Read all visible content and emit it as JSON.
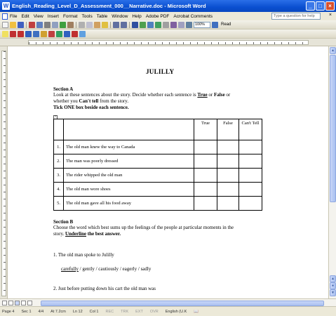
{
  "window": {
    "title": "English_Reading_Level_D_Assessment_000__Narrative.doc - Microsoft Word",
    "minimize": "_",
    "maximize": "□",
    "close": "×"
  },
  "menu": {
    "items": [
      "File",
      "Edit",
      "View",
      "Insert",
      "Format",
      "Tools",
      "Table",
      "Window",
      "Help",
      "Adobe PDF",
      "Acrobat Comments"
    ],
    "help_placeholder": "Type a question for help",
    "close": "×"
  },
  "toolbar": {
    "zoom": "100%",
    "read_label": "Read",
    "colors": {
      "accent": "#0a4fd0"
    }
  },
  "document": {
    "title": "JULILLY",
    "section_a": {
      "heading": "Section A",
      "line1_pre": "Look at these sentences about the story.  Decide whether each sentence is ",
      "true_word": "True",
      "line1_or": " or ",
      "false_word": "False",
      "line1_post": " or",
      "line2_pre": "whether you ",
      "cant_tell": "Can't tell",
      "line2_post": " from the story.",
      "instruction": "Tick ONE box beside each sentence."
    },
    "table": {
      "headers": [
        "True",
        "False",
        "Can't Tell"
      ],
      "rows": [
        {
          "num": "1.",
          "text": "The old man knew the way to Canada"
        },
        {
          "num": "2.",
          "text": "The man was poorly dressed"
        },
        {
          "num": "3.",
          "text": "The rider whipped the old man"
        },
        {
          "num": "4.",
          "text": "The old man wore shoes"
        },
        {
          "num": "5.",
          "text": "The old man gave all his food away"
        }
      ]
    },
    "section_b": {
      "heading": "Section B",
      "line1": "Choose the word which best sums up the feelings of the people at particular moments in the",
      "line2_pre": "story.  ",
      "underline_word": "Underline",
      "line2_post": " the best answer.",
      "q1": "1.  The old man spoke to Julilly",
      "q1_options": [
        "carefully",
        "gently",
        "cautiously",
        "eagerly",
        "sadly"
      ],
      "q2": "2.  Just before putting down his cart the old man was"
    }
  },
  "status": {
    "page": "Page 4",
    "sec": "Sec 1",
    "pages": "4/4",
    "at": "At 7.2cm",
    "ln": "Ln 12",
    "col": "Col 1",
    "modes": [
      "REC",
      "TRK",
      "EXT",
      "OVR"
    ],
    "language": "English (U.K"
  }
}
